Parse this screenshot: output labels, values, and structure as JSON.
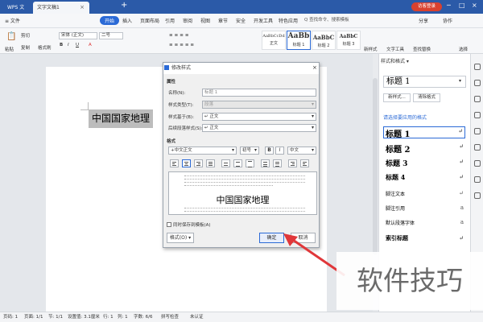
{
  "titlebar": {
    "wps_tab": "WPS 文字",
    "doc_tab": "文字文稿1",
    "login_label": "访客登录"
  },
  "menubar": {
    "file": "≡ 文件",
    "items": [
      "开始",
      "插入",
      "页面布局",
      "引用",
      "审阅",
      "视图",
      "章节",
      "安全",
      "开发工具",
      "特色应用"
    ],
    "search_placeholder": "Q 查找命令、搜索模板",
    "share": "分享",
    "collab": "协作"
  },
  "ribbon": {
    "paste": "粘贴",
    "cut": "剪切",
    "copy": "复制",
    "format_painter": "格式刷",
    "font_name": "宋体 (正文)",
    "font_size": "二号",
    "styles": [
      {
        "preview": "AaBbCcDd",
        "name": "正文"
      },
      {
        "preview": "AaBb",
        "name": "标题 1"
      },
      {
        "preview": "AaBbC",
        "name": "标题 2"
      },
      {
        "preview": "AaBbC",
        "name": "标题 3"
      }
    ],
    "new_style": "新样式",
    "text_tools": "文字工具",
    "find_replace": "查找替换",
    "select": "选择"
  },
  "document": {
    "heading_text": "中国国家地理"
  },
  "dialog": {
    "title": "修改样式",
    "properties_label": "属性",
    "name_label": "名称(N):",
    "name_value": "标题 1",
    "type_label": "样式类型(T):",
    "type_value": "段落",
    "based_label": "样式基于(B):",
    "based_value": "↵ 正文",
    "next_label": "后续段落样式(S):",
    "next_value": "↵ 正文",
    "format_label": "格式",
    "font_value": "+中文正文",
    "size_value": "初号",
    "bold": "B",
    "italic": "I",
    "lang_value": "中文",
    "preview_text": "中国国家地理",
    "add_template_label": "同时保存到模板(A)",
    "format_button": "格式(O) ▾",
    "ok_button": "确定",
    "cancel_button": "取消"
  },
  "style_panel": {
    "title": "样式和格式 ▾",
    "current_style": "标题 1",
    "new_style_button": "新样式...",
    "clear_format_button": "清除格式",
    "subtitle": "请选择要应用的格式",
    "items": [
      {
        "label": "标题 1",
        "mark": "↵"
      },
      {
        "label": "标题 2",
        "mark": "↵"
      },
      {
        "label": "标题 3",
        "mark": "↵"
      },
      {
        "label": "标题 4",
        "mark": "↵"
      },
      {
        "label": "脚注文本",
        "mark": "↵"
      },
      {
        "label": "脚注引用",
        "mark": "a"
      },
      {
        "label": "默认段落字体",
        "mark": "a"
      },
      {
        "label": "索引标题",
        "mark": "↵"
      }
    ]
  },
  "statusbar": {
    "page_num": "页码: 1",
    "pages": "页面: 1/1",
    "section": "节: 1/1",
    "position": "设置值: 3.1厘米",
    "row": "行: 1",
    "col": "列: 1",
    "words": "字数: 6/6",
    "spellcheck": "拼写检查",
    "doc_check": "未认证"
  },
  "watermark": "软件技巧",
  "colors": {
    "accent": "#2b6ad6",
    "titlebar": "#2b5aa8",
    "login": "#d9412f",
    "arrow": "#e0373a"
  }
}
